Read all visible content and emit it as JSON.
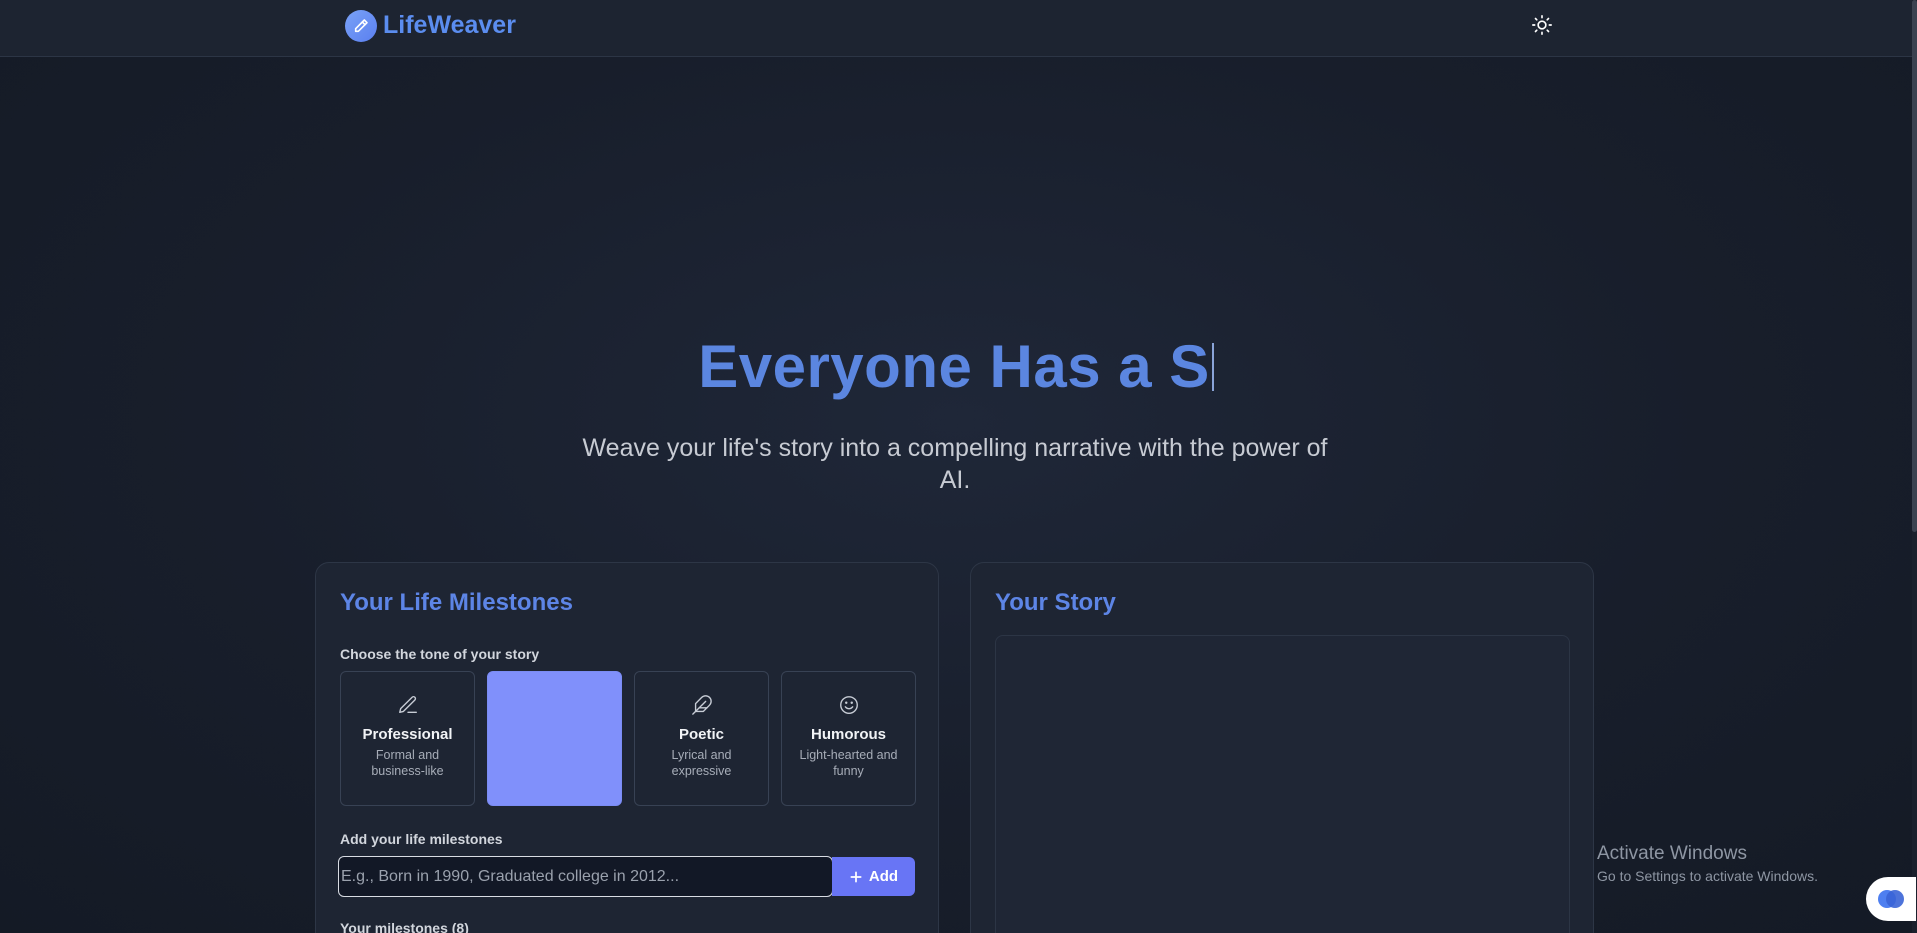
{
  "app": {
    "name": "LifeWeaver",
    "logo_icon": "pencil-icon",
    "theme_toggle_icon": "sun-icon"
  },
  "hero": {
    "title": "Everyone Has a S",
    "subtitle": "Weave your life's story into a compelling narrative with the power of AI."
  },
  "milestones_panel": {
    "title": "Your Life Milestones",
    "tone_label": "Choose the tone of your story",
    "tones": [
      {
        "name": "Professional",
        "desc": "Formal and business-like",
        "icon": "pen-line-icon",
        "selected": false
      },
      {
        "name": "",
        "desc": "",
        "icon": "",
        "selected": true
      },
      {
        "name": "Poetic",
        "desc": "Lyrical and expressive",
        "icon": "feather-icon",
        "selected": false
      },
      {
        "name": "Humorous",
        "desc": "Light-hearted and funny",
        "icon": "smile-icon",
        "selected": false
      }
    ],
    "add_label": "Add your life milestones",
    "input_placeholder": "E.g., Born in 1990, Graduated college in 2012...",
    "input_value": "",
    "add_button": "Add",
    "milestones_count_label": "Your milestones (8)"
  },
  "story_panel": {
    "title": "Your Story"
  },
  "watermark": {
    "title": "Activate Windows",
    "subtitle": "Go to Settings to activate Windows."
  },
  "colors": {
    "accent": "#5b86e0",
    "button": "#6875f5",
    "selected_tone": "#8090fb"
  }
}
